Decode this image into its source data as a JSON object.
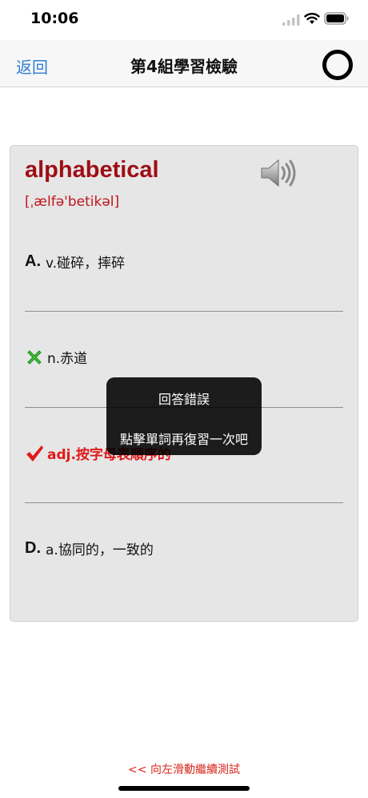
{
  "status_bar": {
    "time": "10:06"
  },
  "nav": {
    "back_label": "返回",
    "title": "第4組學習檢驗"
  },
  "card": {
    "word": "alphabetical",
    "phonetic": "[ˌælfə'betikəl]",
    "options": [
      {
        "letter": "A.",
        "text": "v.碰碎，摔碎",
        "state": "normal"
      },
      {
        "letter": "",
        "text": "n.赤道",
        "state": "wrong",
        "icon": "cross-icon"
      },
      {
        "letter": "",
        "text": "adj.按字母表順序的",
        "state": "correct",
        "icon": "check-icon"
      },
      {
        "letter": "D.",
        "text": "a.協同的，一致的",
        "state": "normal"
      }
    ]
  },
  "toast": {
    "line1": "回答錯誤",
    "line2": "點擊單詞再復習一次吧"
  },
  "footer": {
    "swipe_hint": "<< 向左滑動繼續測試"
  },
  "colors": {
    "accent_blue": "#2f7fd6",
    "word_red": "#9e0e15",
    "correct_red": "#e11919",
    "wrong_green": "#3fbf3a",
    "card_bg": "#e6e6e6"
  }
}
